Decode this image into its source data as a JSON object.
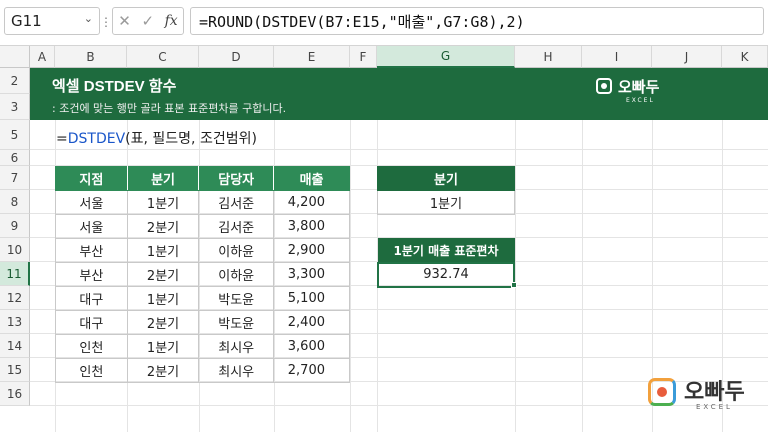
{
  "formula_bar": {
    "name_box": "G11",
    "fx_label": "fx",
    "formula": "=ROUND(DSTDEV(B7:E15,\"매출\",G7:G8),2)"
  },
  "columns": [
    "A",
    "B",
    "C",
    "D",
    "E",
    "F",
    "G",
    "H",
    "I",
    "J",
    "K"
  ],
  "rows": [
    "2",
    "3",
    "5",
    "6",
    "7",
    "8",
    "9",
    "10",
    "11",
    "12",
    "13",
    "14",
    "15",
    "16"
  ],
  "selected_cell": {
    "column": "G",
    "row": "11"
  },
  "banner": {
    "title": "엑셀 DSTDEV 함수",
    "subtitle": ": 조건에 맞는 행만 골라 표본 표준편차를 구합니다.",
    "logo_text": "오빠두",
    "logo_sub": "EXCEL"
  },
  "syntax": {
    "prefix": "=",
    "function": "DSTDEV",
    "args": "(표, 필드명, 조건범위)"
  },
  "data_table": {
    "headers": [
      "지점",
      "분기",
      "담당자",
      "매출"
    ],
    "rows": [
      [
        "서울",
        "1분기",
        "김서준",
        "4,200"
      ],
      [
        "서울",
        "2분기",
        "김서준",
        "3,800"
      ],
      [
        "부산",
        "1분기",
        "이하윤",
        "2,900"
      ],
      [
        "부산",
        "2분기",
        "이하윤",
        "3,300"
      ],
      [
        "대구",
        "1분기",
        "박도윤",
        "5,100"
      ],
      [
        "대구",
        "2분기",
        "박도윤",
        "2,400"
      ],
      [
        "인천",
        "1분기",
        "최시우",
        "3,600"
      ],
      [
        "인천",
        "2분기",
        "최시우",
        "2,700"
      ]
    ]
  },
  "criteria": {
    "header": "분기",
    "value": "1분기"
  },
  "result": {
    "header": "1분기 매출 표준편차",
    "value": "932.74"
  },
  "footer_logo": {
    "text": "오빠두",
    "sub": "EXCEL"
  },
  "colors": {
    "banner": "#1e6b3e",
    "table_header": "#2e8b57",
    "selection": "#217346",
    "syntax_fn": "#1a56c9"
  }
}
